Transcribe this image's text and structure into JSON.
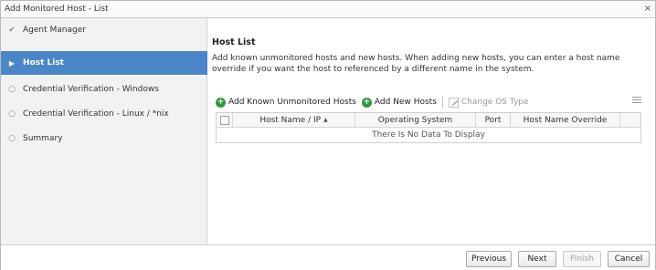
{
  "window": {
    "title": "Add Monitored Host - List",
    "close_glyph": "×"
  },
  "sidebar": {
    "items": [
      {
        "label": "Agent Manager",
        "mark": "✔",
        "state": "done"
      },
      {
        "label": "Host List",
        "mark": "▶",
        "state": "active"
      },
      {
        "label": "Credential Verification - Windows",
        "mark": "○",
        "state": "pending"
      },
      {
        "label": "Credential Verification - Linux / *nix",
        "mark": "○",
        "state": "pending"
      },
      {
        "label": "Summary",
        "mark": "○",
        "state": "pending"
      }
    ]
  },
  "main": {
    "title": "Host List",
    "description": "Add known unmonitored hosts and new hosts. When adding new hosts, you can enter a host name override if you want the host to referenced by a different name in the system.",
    "toolbar": {
      "add_known": "Add Known Unmonitored Hosts",
      "add_new": "Add New Hosts",
      "change_os": "Change OS Type"
    },
    "grid": {
      "columns": [
        "Host Name / IP",
        "Operating System",
        "Port",
        "Host Name Override"
      ],
      "sort_indicator": "▲",
      "empty_text": "There Is No Data To Display"
    }
  },
  "footer": {
    "previous": "Previous",
    "next": "Next",
    "finish": "Finish",
    "cancel": "Cancel"
  },
  "colors": {
    "accent": "#4a86c8",
    "add_icon": "#2e9b3b"
  }
}
